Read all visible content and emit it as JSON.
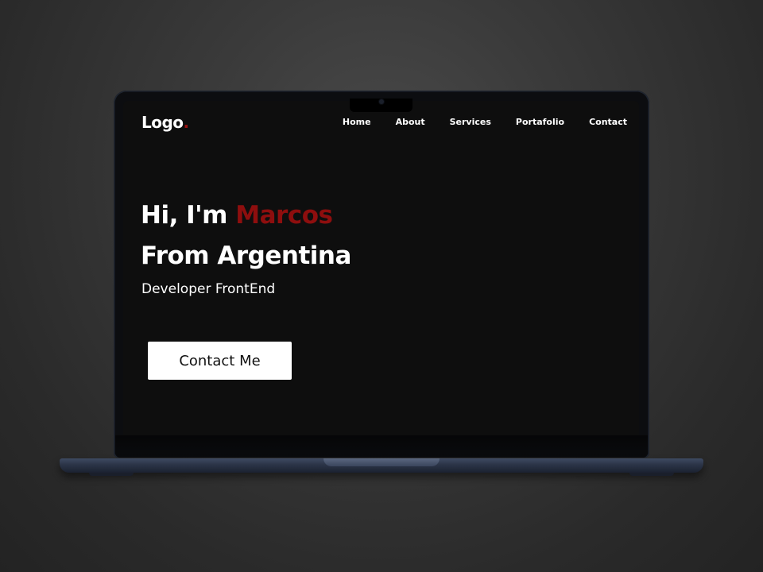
{
  "site": {
    "logo_text": "Logo",
    "logo_dot": ".",
    "nav": [
      {
        "label": "Home"
      },
      {
        "label": "About"
      },
      {
        "label": "Services"
      },
      {
        "label": "Portafolio"
      },
      {
        "label": "Contact"
      }
    ],
    "hero": {
      "greeting": "Hi, I'm ",
      "name": "Marcos",
      "origin": "From Argentina",
      "role": "Developer FrontEnd",
      "cta_label": "Contact Me"
    }
  },
  "colors": {
    "accent": "#8e0e0e",
    "page_background": "#0e0e0e",
    "text": "#ffffff",
    "button_background": "#ffffff"
  },
  "icons": {
    "camera": "webcam-icon"
  }
}
